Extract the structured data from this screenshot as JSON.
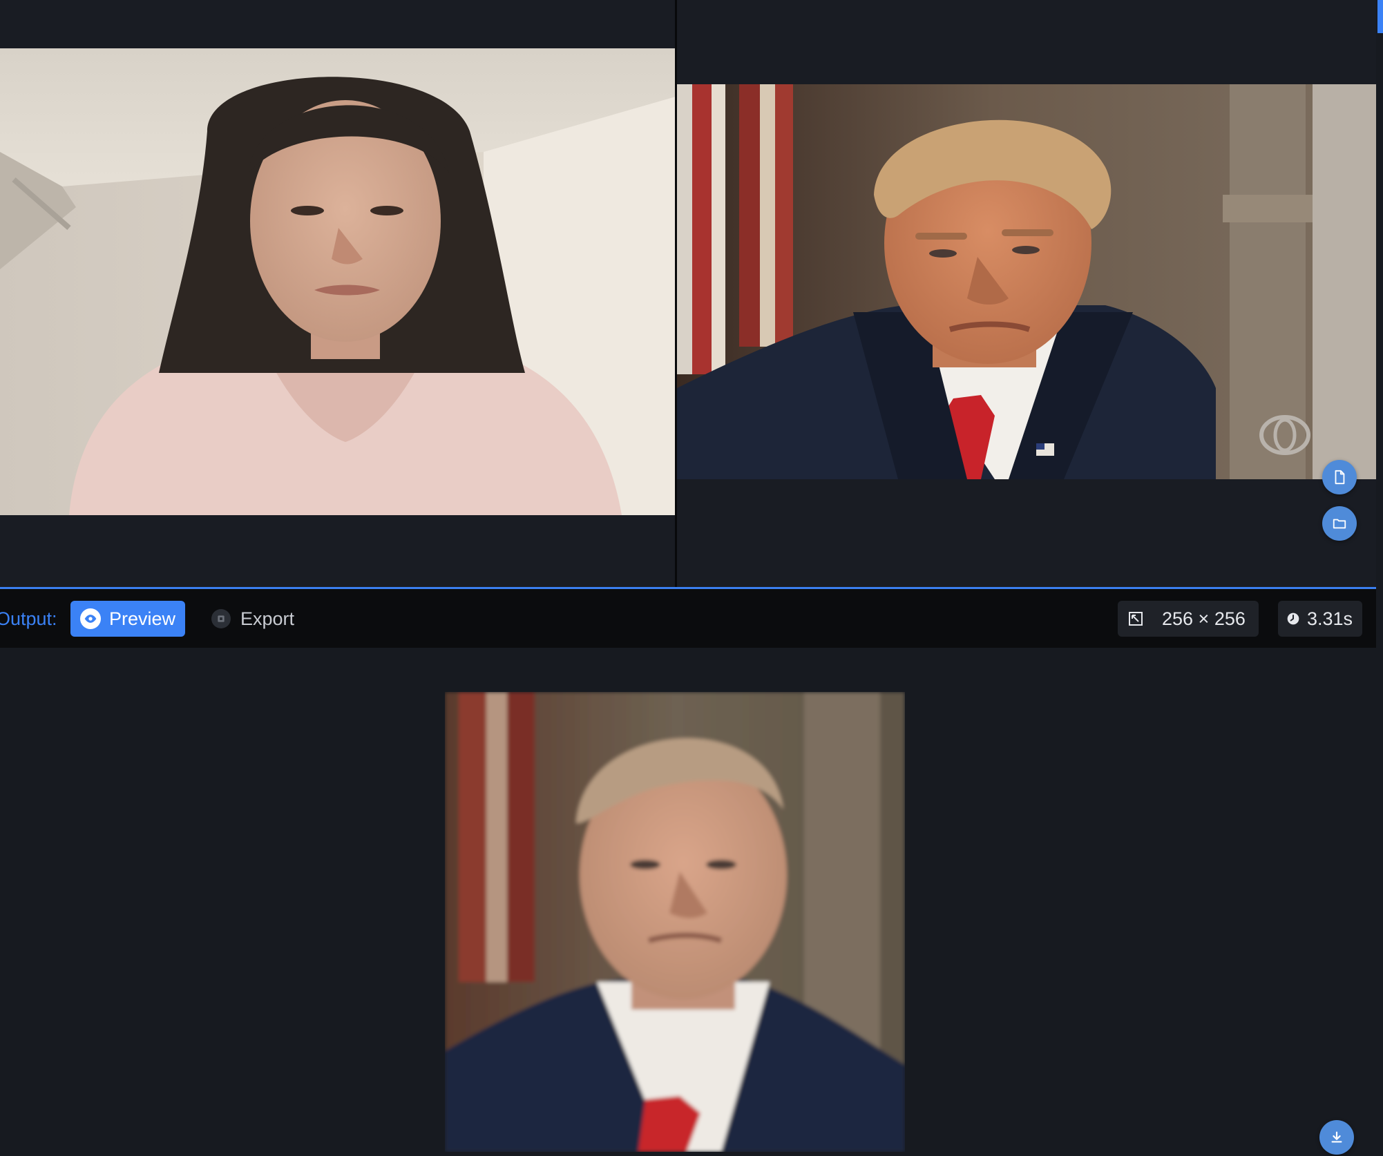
{
  "source_panel": {
    "image": "source-face-photo-woman-pink-shirt"
  },
  "target_panel": {
    "image": "target-face-photo-man-suit-red-tie",
    "actions": [
      "file-icon",
      "folder-icon"
    ]
  },
  "toolbar": {
    "output_label": "Output:",
    "tabs": [
      {
        "label": "Preview",
        "icon": "eye-icon",
        "active": true
      },
      {
        "label": "Export",
        "icon": "export-icon",
        "active": false
      }
    ],
    "resolution": "256 × 256",
    "resolution_icon": "resize-icon",
    "duration": "3.31s",
    "duration_icon": "clock-icon"
  },
  "result_panel": {
    "image": "swapped-result-photo",
    "action_icon": "download-icon"
  },
  "colors": {
    "accent": "#3b82f6",
    "background": "#171a20",
    "toolbar": "#0b0c0e",
    "round_button": "#4f8bd9"
  }
}
